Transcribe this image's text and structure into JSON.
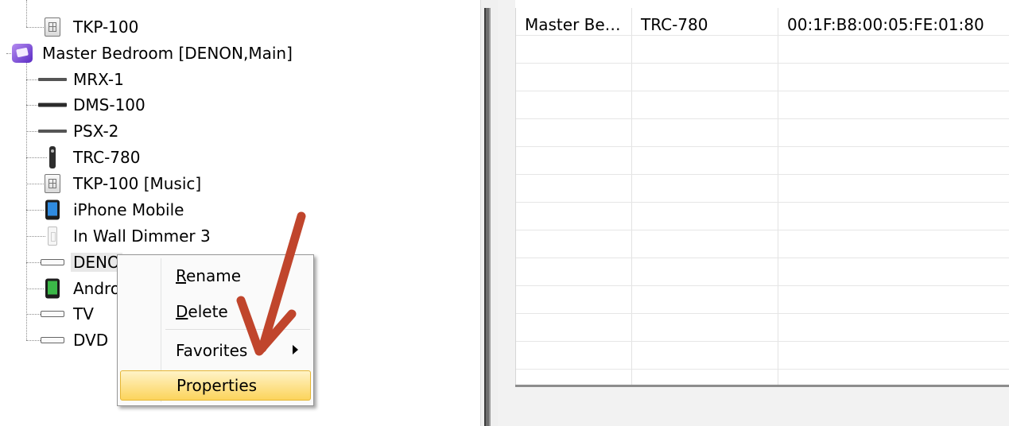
{
  "tree": {
    "items": [
      {
        "label": "TKP-100",
        "icon": "keypad-icon"
      },
      {
        "label": "Master Bedroom [DENON,Main]",
        "icon": "room-icon"
      },
      {
        "label": "MRX-1",
        "icon": "receiver-icon"
      },
      {
        "label": "DMS-100",
        "icon": "media-server-icon"
      },
      {
        "label": "PSX-2",
        "icon": "processor-icon"
      },
      {
        "label": "TRC-780",
        "icon": "remote-icon"
      },
      {
        "label": "TKP-100 [Music]",
        "icon": "keypad-icon"
      },
      {
        "label": "iPhone Mobile",
        "icon": "iphone-icon"
      },
      {
        "label": "In Wall Dimmer 3",
        "icon": "dimmer-icon"
      },
      {
        "label": "DENO",
        "icon": "vcr-icon"
      },
      {
        "label": "Andro",
        "icon": "android-icon"
      },
      {
        "label": "TV",
        "icon": "vcr-icon"
      },
      {
        "label": "DVD",
        "icon": "vcr-icon"
      }
    ]
  },
  "grid": {
    "rows": [
      {
        "name": "Master Be…",
        "model": "TRC-780",
        "mac": "00:1F:B8:00:05:FE:01:80"
      }
    ]
  },
  "context_menu": {
    "rename": {
      "accel": "R",
      "rest": "ename"
    },
    "delete": {
      "accel": "D",
      "rest": "elete"
    },
    "favorites": {
      "label": "Favorites"
    },
    "properties": {
      "label": "Properties"
    }
  },
  "colors": {
    "annotation_arrow": "#c0452c",
    "menu_highlight": "#fcd45c"
  }
}
